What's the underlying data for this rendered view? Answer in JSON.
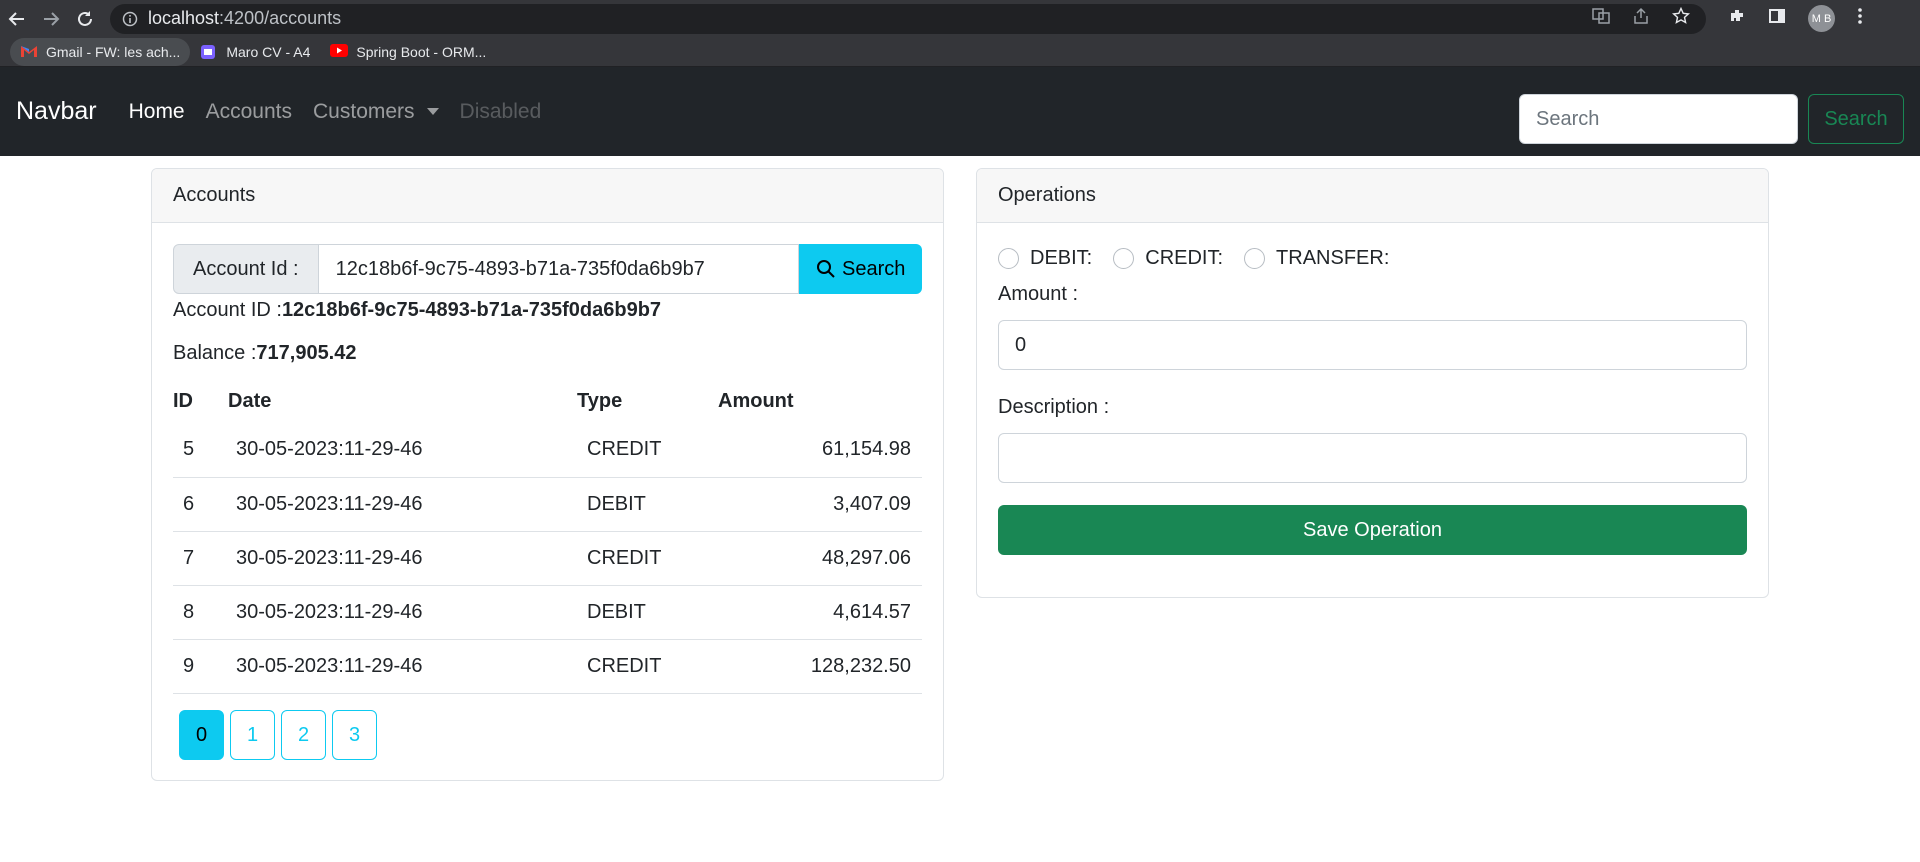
{
  "browser": {
    "url_host": "localhost",
    "url_rest": ":4200/accounts",
    "profile_initials": "M B",
    "bookmarks": [
      {
        "label": "Gmail - FW: les ach..."
      },
      {
        "label": "Maro CV - A4"
      },
      {
        "label": "Spring Boot - ORM..."
      }
    ]
  },
  "navbar": {
    "brand": "Navbar",
    "links": [
      {
        "label": "Home"
      },
      {
        "label": "Accounts"
      },
      {
        "label": "Customers"
      },
      {
        "label": "Disabled"
      }
    ],
    "search_placeholder": "Search",
    "search_button": "Search"
  },
  "accounts": {
    "title": "Accounts",
    "search_label": "Account Id :",
    "search_value": "12c18b6f-9c75-4893-b71a-735f0da6b9b7",
    "search_button": "Search",
    "account_id_label": "Account ID :",
    "account_id_value": "12c18b6f-9c75-4893-b71a-735f0da6b9b7",
    "balance_label": "Balance :",
    "balance_value": "717,905.42",
    "columns": [
      "ID",
      "Date",
      "Type",
      "Amount"
    ],
    "rows": [
      {
        "id": "5",
        "date": "30-05-2023:11-29-46",
        "type": "CREDIT",
        "amount": "61,154.98"
      },
      {
        "id": "6",
        "date": "30-05-2023:11-29-46",
        "type": "DEBIT",
        "amount": "3,407.09"
      },
      {
        "id": "7",
        "date": "30-05-2023:11-29-46",
        "type": "CREDIT",
        "amount": "48,297.06"
      },
      {
        "id": "8",
        "date": "30-05-2023:11-29-46",
        "type": "DEBIT",
        "amount": "4,614.57"
      },
      {
        "id": "9",
        "date": "30-05-2023:11-29-46",
        "type": "CREDIT",
        "amount": "128,232.50"
      }
    ],
    "pages": [
      "0",
      "1",
      "2",
      "3"
    ],
    "current_page": "0"
  },
  "operations": {
    "title": "Operations",
    "types": [
      {
        "label": "DEBIT:"
      },
      {
        "label": "CREDIT:"
      },
      {
        "label": "TRANSFER:"
      }
    ],
    "amount_label": "Amount :",
    "amount_value": "0",
    "description_label": "Description :",
    "description_value": "",
    "save_button": "Save Operation"
  },
  "colors": {
    "navbar_bg": "#212529",
    "info": "#0dcaf0",
    "success": "#198754"
  }
}
